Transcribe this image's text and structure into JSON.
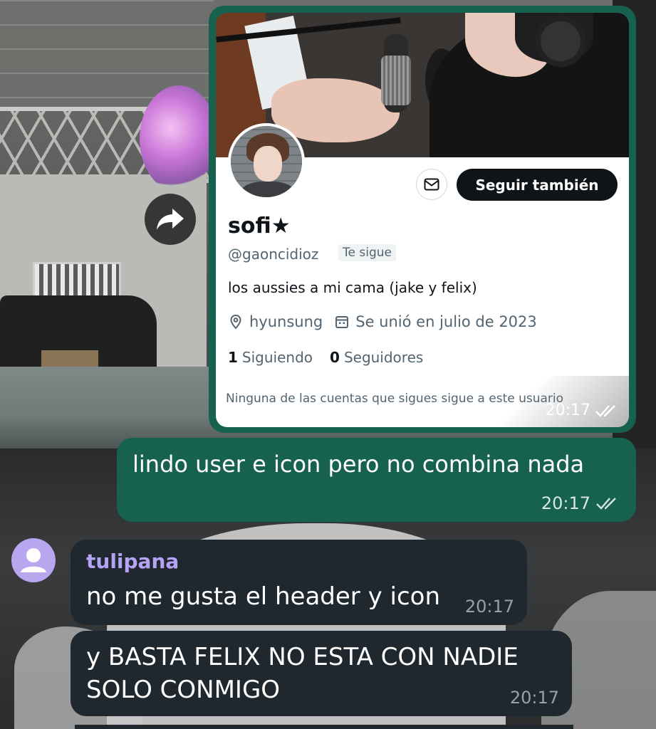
{
  "screenshot_message": {
    "profile": {
      "follow_button_label": "Seguir también",
      "display_name": "sofi★",
      "handle": "@gaoncidioz",
      "follows_you_badge": "Te sigue",
      "bio": "los aussies a mi cama (jake y felix)",
      "location": "hyunsung",
      "joined": "Se unió en julio de 2023",
      "following_count": "1",
      "following_label": "Siguiendo",
      "followers_count": "0",
      "followers_label": "Seguidores",
      "mutuals_note": "Ninguna de las cuentas que sigues sigue a este usuario"
    },
    "time": "20:17"
  },
  "outgoing_message": {
    "text": "lindo user e icon pero no combina nada",
    "time": "20:17"
  },
  "incoming_messages": [
    {
      "sender": "tulipana",
      "text": "no me gusta el header y icon",
      "time": "20:17"
    },
    {
      "text": "y BASTA FELIX NO ESTA CON NADIE SOLO CONMIGO",
      "time": "20:17"
    }
  ],
  "colors": {
    "outgoing_bubble": "#16624f",
    "incoming_bubble": "#1f282f",
    "sender_name": "#b6a3f6",
    "avatar_placeholder": "#b8a7ef"
  },
  "icons": {
    "forward": "forward-arrow-icon",
    "mail": "envelope-icon",
    "location": "location-pin-icon",
    "calendar": "calendar-icon",
    "read_receipt": "double-check-icon",
    "user_avatar": "person-icon"
  }
}
